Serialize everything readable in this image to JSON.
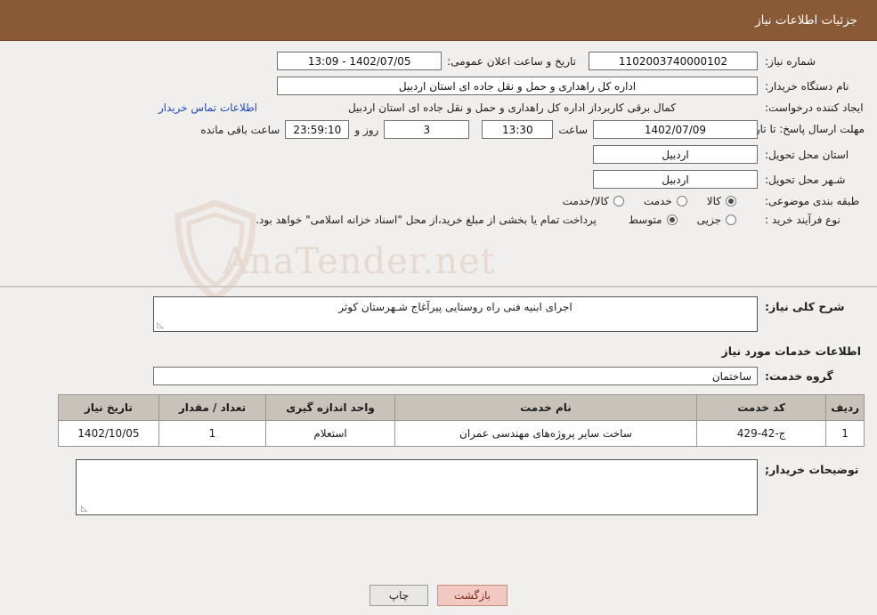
{
  "header": {
    "title": "جزئیات اطلاعات نیاز"
  },
  "watermark": {
    "text": "AnaTender.net"
  },
  "form": {
    "need_number_label": "شماره نیاز:",
    "need_number_value": "1102003740000102",
    "public_announce_label": "تاریخ و ساعت اعلان عمومی:",
    "public_announce_value": "13:09 - 1402/07/05",
    "buyer_org_label": "نام دستگاه خریدار:",
    "buyer_org_value": "اداره کل راهداری و حمل و نقل جاده ای استان اردبیل",
    "creator_label": "ایجاد کننده درخواست:",
    "creator_value": "کمال برقی کاربرداز اداره کل راهداری و حمل و نقل جاده ای استان اردبیل",
    "contact_link": "اطلاعات تماس خریدار",
    "deadline_label": "مهلت ارسال پاسخ: تا تاریخ:",
    "deadline_date": "1402/07/09",
    "hour_label": "ساعت",
    "deadline_time": "13:30",
    "days_value": "3",
    "days_label": "روز و",
    "countdown_value": "23:59:10",
    "remaining_label": "ساعت باقی مانده",
    "province_label": "استان محل تحویل:",
    "province_value": "اردبیل",
    "city_label": "شـهر محل تحویل:",
    "city_value": "اردبیل",
    "category_label": "طبقه بندی موضوعی:",
    "category_options": [
      {
        "label": "کالا",
        "checked": true
      },
      {
        "label": "خدمت",
        "checked": false
      },
      {
        "label": "کالا/خدمت",
        "checked": false
      }
    ],
    "purchase_type_label": "نوع فرآیند خرید :",
    "purchase_type_options": [
      {
        "label": "جزیی",
        "checked": false
      },
      {
        "label": "متوسط",
        "checked": true
      }
    ],
    "purchase_note": "پرداخت تمام یا بخشی از مبلغ خرید،از محل \"اسناد خزانه اسلامی\" خواهد بود."
  },
  "description": {
    "label": "شرح کلی نیاز:",
    "value": "اجرای ابنیه فنی راه روستایی پیرآغاج شـهرستان کوثر"
  },
  "services": {
    "section_title": "اطلاعات خدمات مورد نیاز",
    "group_label": "گروه خدمت:",
    "group_value": "ساختمان",
    "columns": [
      "ردیف",
      "کد خدمت",
      "نام خدمت",
      "واحد اندازه گیری",
      "تعداد / مقدار",
      "تاریخ نیاز"
    ],
    "rows": [
      {
        "index": "1",
        "code": "ج-42-429",
        "name": "ساخت سایر پروژه‌های مهندسی عمران",
        "unit": "استعلام",
        "qty": "1",
        "date": "1402/10/05"
      }
    ]
  },
  "notes": {
    "label": "توضیحات خریدار;",
    "value": ""
  },
  "footer": {
    "print_label": "چاپ",
    "back_label": "بازگشت"
  }
}
